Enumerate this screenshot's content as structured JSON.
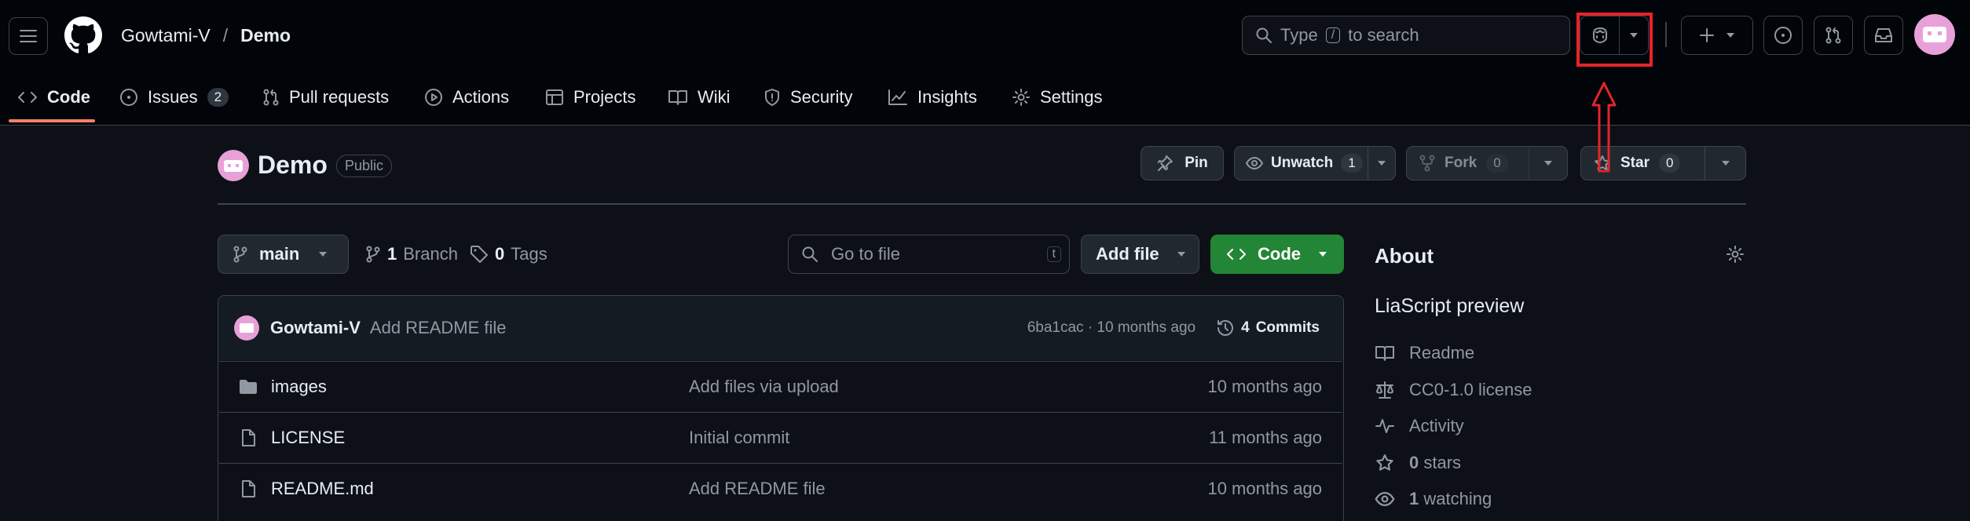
{
  "header": {
    "owner": "Gowtami-V",
    "separator": "/",
    "repo": "Demo",
    "search_placeholder_pre": "Type",
    "search_key": "/",
    "search_placeholder_post": "to search"
  },
  "tabs": [
    {
      "label": "Code",
      "icon": "code-icon",
      "active": true
    },
    {
      "label": "Issues",
      "icon": "issue-icon",
      "count": "2"
    },
    {
      "label": "Pull requests",
      "icon": "pull-request-icon"
    },
    {
      "label": "Actions",
      "icon": "play-icon"
    },
    {
      "label": "Projects",
      "icon": "table-icon"
    },
    {
      "label": "Wiki",
      "icon": "book-icon"
    },
    {
      "label": "Security",
      "icon": "shield-icon"
    },
    {
      "label": "Insights",
      "icon": "graph-icon"
    },
    {
      "label": "Settings",
      "icon": "gear-icon"
    }
  ],
  "repo_header": {
    "name": "Demo",
    "visibility": "Public",
    "pin": "Pin",
    "unwatch": "Unwatch",
    "watch_count": "1",
    "fork": "Fork",
    "fork_count": "0",
    "star": "Star",
    "star_count": "0"
  },
  "toolbar": {
    "branch": "main",
    "branch_count": "1",
    "branch_label": "Branch",
    "tag_count": "0",
    "tag_label": "Tags",
    "goto_placeholder": "Go to file",
    "goto_key": "t",
    "add_file": "Add file",
    "code": "Code"
  },
  "commit": {
    "author": "Gowtami-V",
    "message": "Add README file",
    "meta": "6ba1cac · 10 months ago",
    "commits_count": "4",
    "commits_label": "Commits"
  },
  "files": [
    {
      "name": "images",
      "type": "folder",
      "message": "Add files via upload",
      "time": "10 months ago"
    },
    {
      "name": "LICENSE",
      "type": "file",
      "message": "Initial commit",
      "time": "11 months ago"
    },
    {
      "name": "README.md",
      "type": "file",
      "message": "Add README file",
      "time": "10 months ago"
    }
  ],
  "about": {
    "title": "About",
    "description": "LiaScript preview",
    "readme": "Readme",
    "license": "CC0-1.0 license",
    "activity": "Activity",
    "stars_count": "0",
    "stars_label": "stars",
    "watching_count": "1",
    "watching_label": "watching"
  },
  "colors": {
    "background": "#0d1117",
    "green_button": "#238636",
    "highlight_box": "#e5242a",
    "tab_underline": "#f78166",
    "avatar": "#e8a0d8"
  }
}
